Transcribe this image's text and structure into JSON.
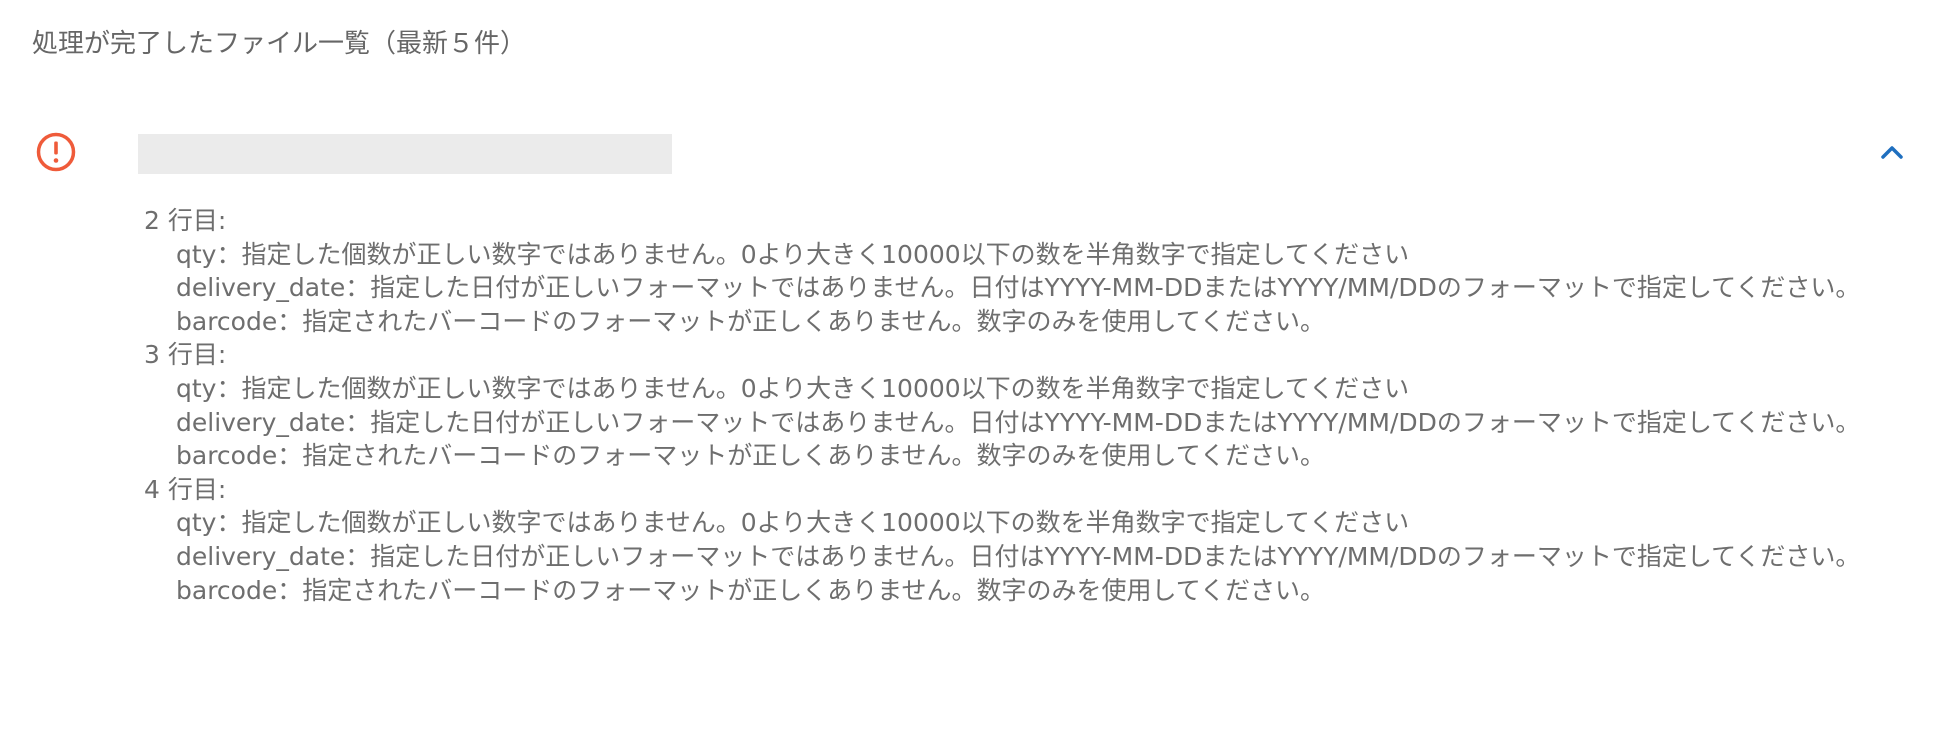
{
  "section": {
    "title": "処理が完了したファイル一覧（最新５件）"
  },
  "colors": {
    "alert": "#ef5b3a",
    "toggle": "#1f6fbf",
    "text": "#6e6e6e",
    "placeholder_bar": "#ebebeb"
  },
  "file": {
    "status_icon": "alert-circle-icon",
    "toggle_icon": "chevron-up-icon",
    "rows": [
      {
        "header": "2 行目:",
        "errors": [
          {
            "field": "qty",
            "sep": "：",
            "message": "指定した個数が正しい数字ではありません。0より大きく10000以下の数を半角数字で指定してください"
          },
          {
            "field": "delivery_date",
            "sep": "：",
            "message": "指定した日付が正しいフォーマットではありません。日付はYYYY-MM-DDまたはYYYY/MM/DDのフォーマットで指定してください。"
          },
          {
            "field": "barcode",
            "sep": "：",
            "message": "指定されたバーコードのフォーマットが正しくありません。数字のみを使用してください。"
          }
        ]
      },
      {
        "header": "3 行目:",
        "errors": [
          {
            "field": "qty",
            "sep": "：",
            "message": "指定した個数が正しい数字ではありません。0より大きく10000以下の数を半角数字で指定してください"
          },
          {
            "field": "delivery_date",
            "sep": "：",
            "message": "指定した日付が正しいフォーマットではありません。日付はYYYY-MM-DDまたはYYYY/MM/DDのフォーマットで指定してください。"
          },
          {
            "field": "barcode",
            "sep": "：",
            "message": "指定されたバーコードのフォーマットが正しくありません。数字のみを使用してください。"
          }
        ]
      },
      {
        "header": "4 行目:",
        "errors": [
          {
            "field": "qty",
            "sep": "：",
            "message": "指定した個数が正しい数字ではありません。0より大きく10000以下の数を半角数字で指定してください"
          },
          {
            "field": "delivery_date",
            "sep": "：",
            "message": "指定した日付が正しいフォーマットではありません。日付はYYYY-MM-DDまたはYYYY/MM/DDのフォーマットで指定してください。"
          },
          {
            "field": "barcode",
            "sep": "：",
            "message": "指定されたバーコードのフォーマットが正しくありません。数字のみを使用してください。"
          }
        ]
      }
    ]
  }
}
